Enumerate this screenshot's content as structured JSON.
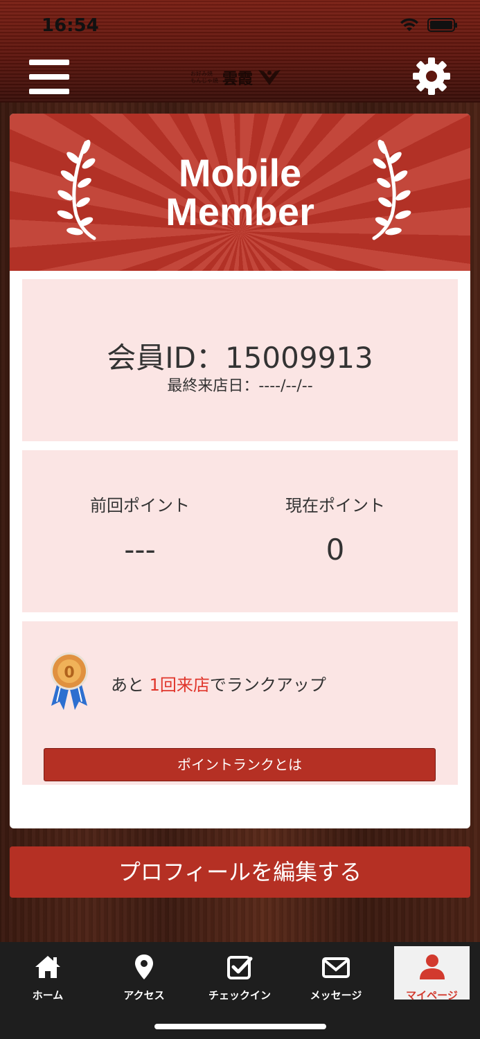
{
  "status_bar": {
    "time": "16:54"
  },
  "header": {
    "logo_small": "お好み焼\nもんじゃ焼",
    "logo_main": "雲霞"
  },
  "card": {
    "banner_title_line1": "Mobile",
    "banner_title_line2": "Member",
    "member_id": "会員ID：15009913",
    "last_visit": "最終来店日：----/--/--",
    "previous_points_label": "前回ポイント",
    "previous_points_value": "---",
    "current_points_label": "現在ポイント",
    "current_points_value": "0",
    "rank_medal_number": "0",
    "rank_text_prefix": "あと ",
    "rank_text_highlight": "1回来店",
    "rank_text_suffix": "でランクアップ",
    "rank_button_label": "ポイントランクとは"
  },
  "edit_profile_button": "プロフィールを編集する",
  "tabbar": {
    "items": [
      {
        "label": "ホーム",
        "icon": "home-icon"
      },
      {
        "label": "アクセス",
        "icon": "map-pin-icon"
      },
      {
        "label": "チェックイン",
        "icon": "checkin-icon"
      },
      {
        "label": "メッセージ",
        "icon": "envelope-icon"
      },
      {
        "label": "マイページ",
        "icon": "person-icon",
        "active": true
      }
    ]
  },
  "colors": {
    "accent": "#b53024",
    "highlight": "#e0352b",
    "panel_bg": "#fbe5e4",
    "tabbar_bg": "#1e1e1e"
  }
}
